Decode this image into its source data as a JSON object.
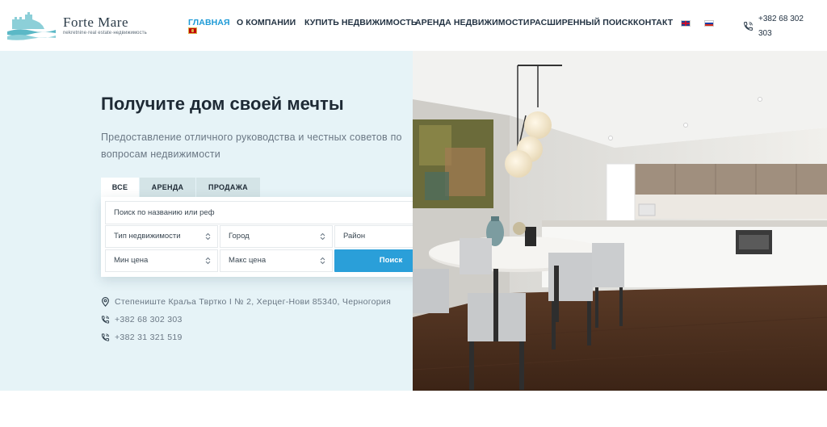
{
  "brand": {
    "name": "Forte Mare",
    "tagline": "nekretnine·real estate·недвижимость"
  },
  "nav": {
    "items": [
      {
        "label": "ГЛАВНАЯ",
        "active": true
      },
      {
        "label": "О КОМПАНИИ",
        "active": false
      },
      {
        "label": "КУПИТЬ НЕДВИЖИМОСТЬ",
        "active": false
      },
      {
        "label": "АРЕНДА НЕДВИЖИМОСТИ",
        "active": false
      },
      {
        "label": "РАСШИРЕННЫЙ ПОИСК",
        "active": false
      },
      {
        "label": "КОНТАКТ",
        "active": false
      }
    ],
    "languages": [
      "montenegro-flag-icon",
      "uk-flag-icon",
      "russia-flag-icon"
    ],
    "phone": "+382 68 302 303"
  },
  "hero": {
    "title": "Получите дом своей мечты",
    "subtitle": "Предоставление отличного руководства и честных советов по вопросам недвижимости"
  },
  "search": {
    "tabs": [
      {
        "label": "ВСЕ",
        "active": true
      },
      {
        "label": "АРЕНДА",
        "active": false
      },
      {
        "label": "ПРОДАЖА",
        "active": false
      }
    ],
    "query_placeholder": "Поиск по названию или реф",
    "type_placeholder": "Тип недвижимости",
    "city_placeholder": "Город",
    "district_placeholder": "Район",
    "min_price_placeholder": "Мин цена",
    "max_price_placeholder": "Макс цена",
    "submit_label": "Поиск"
  },
  "contacts": {
    "address": "Степениште Краља Твртко I № 2, Херцег-Нови 85340, Черногория",
    "phone_1": "+382 68 302 303",
    "phone_2": "+382 31 321 519"
  },
  "colors": {
    "accent": "#1d9ad6",
    "button": "#2a9fd9",
    "hero_background": "#e6f3f7",
    "tab_inactive": "#d4e4e7"
  }
}
